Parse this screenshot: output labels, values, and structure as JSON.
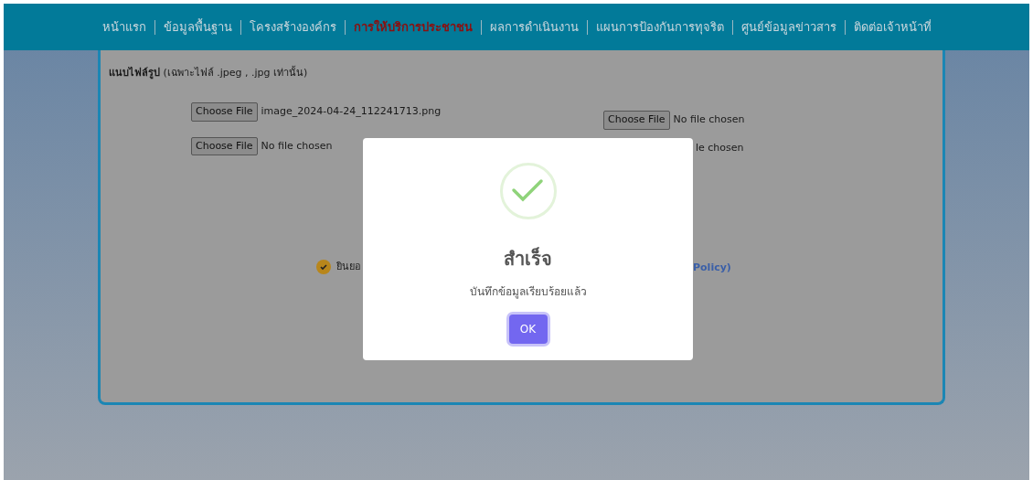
{
  "nav": [
    {
      "label": "หน้าแรก",
      "selected": false
    },
    {
      "label": "ข้อมูลพื้นฐาน",
      "selected": false
    },
    {
      "label": "โครงสร้างองค์กร",
      "selected": false
    },
    {
      "label": "การให้บริการประชาชน",
      "selected": true
    },
    {
      "label": "ผลการดำเนินงาน",
      "selected": false
    },
    {
      "label": "แผนการป้องกันการทุจริต",
      "selected": false
    },
    {
      "label": "ศูนย์ข้อมูลข่าวสาร",
      "selected": false
    },
    {
      "label": "ติดต่อเจ้าหน้าที่",
      "selected": false
    }
  ],
  "form": {
    "attach_label": "**แนบไฟล์รูป** (เฉพาะไฟล์ .jpeg , .jpg เท่านั้น)",
    "left_files": [
      {
        "button": "Choose File",
        "file": "image_2024-04-24_112241713.png"
      },
      {
        "button": "Choose File",
        "file": "No file chosen"
      }
    ],
    "right_files": [
      {
        "button": "Choose File",
        "file": "No file chosen"
      }
    ],
    "right_file_partial": "le chosen",
    "consent": {
      "checked": true,
      "text_start": "ยินยอ",
      "text_end": "Policy)"
    }
  },
  "dialog": {
    "title": "สำเร็จ",
    "message": "บันทึกข้อมูลเรียบร้อยแล้ว",
    "button": "OK"
  }
}
